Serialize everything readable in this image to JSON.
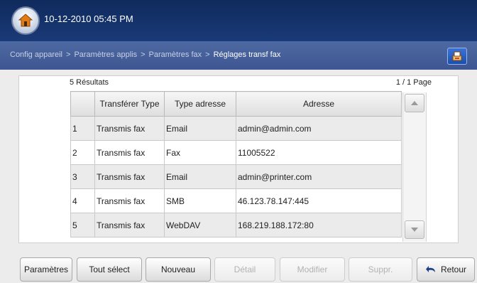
{
  "header": {
    "datetime": "10-12-2010 05:45 PM"
  },
  "breadcrumb": {
    "items": [
      "Config appareil",
      "Paramètres applis",
      "Paramètres fax",
      "Réglages transf fax"
    ],
    "separator": ">"
  },
  "results": {
    "count_text": "5 Résultats",
    "page_text": "1 / 1 Page"
  },
  "table": {
    "headers": [
      "",
      "Transférer Type",
      "Type adresse",
      "Adresse"
    ],
    "rows": [
      {
        "num": "1",
        "type": "Transmis fax",
        "addr_type": "Email",
        "address": "admin@admin.com"
      },
      {
        "num": "2",
        "type": "Transmis fax",
        "addr_type": "Fax",
        "address": "11005522"
      },
      {
        "num": "3",
        "type": "Transmis fax",
        "addr_type": "Email",
        "address": "admin@printer.com"
      },
      {
        "num": "4",
        "type": "Transmis fax",
        "addr_type": "SMB",
        "address": "46.123.78.147:445"
      },
      {
        "num": "5",
        "type": "Transmis fax",
        "addr_type": "WebDAV",
        "address": "168.219.188.172:80"
      }
    ]
  },
  "buttons": {
    "parametres": "Paramètres",
    "tout_select": "Tout sélect",
    "nouveau": "Nouveau",
    "detail": "Détail",
    "modifier": "Modifier",
    "suppr": "Suppr.",
    "retour": "Retour"
  },
  "icons": {
    "home": "home-icon",
    "job_status": "job-status-icon",
    "scroll_up": "arrow-up-icon",
    "scroll_down": "arrow-down-icon",
    "back": "back-arrow-icon"
  },
  "colors": {
    "header_bg": "#0f2a5c",
    "breadcrumb_bg": "#4f6aa3",
    "accent": "#1a4fb0"
  }
}
